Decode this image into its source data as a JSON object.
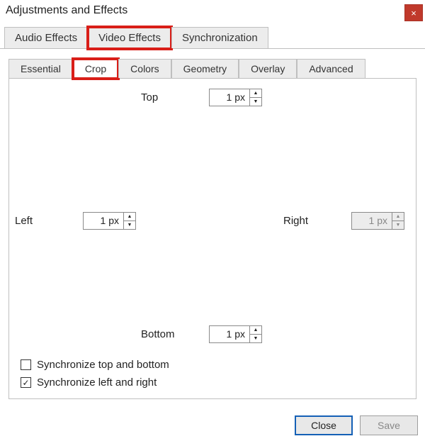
{
  "window": {
    "title": "Adjustments and Effects",
    "close_icon": "×"
  },
  "tabs_primary": [
    {
      "label": "Audio Effects",
      "active": false,
      "highlight": false
    },
    {
      "label": "Video Effects",
      "active": false,
      "highlight": true
    },
    {
      "label": "Synchronization",
      "active": false,
      "highlight": false
    }
  ],
  "tabs_secondary": [
    {
      "label": "Essential",
      "active": false,
      "highlight": false
    },
    {
      "label": "Crop",
      "active": true,
      "highlight": true
    },
    {
      "label": "Colors",
      "active": false,
      "highlight": false
    },
    {
      "label": "Geometry",
      "active": false,
      "highlight": false
    },
    {
      "label": "Overlay",
      "active": false,
      "highlight": false
    },
    {
      "label": "Advanced",
      "active": false,
      "highlight": false
    }
  ],
  "crop": {
    "top": {
      "label": "Top",
      "value": "1 px",
      "enabled": true
    },
    "left": {
      "label": "Left",
      "value": "1 px",
      "enabled": true
    },
    "right": {
      "label": "Right",
      "value": "1 px",
      "enabled": false
    },
    "bottom": {
      "label": "Bottom",
      "value": "1 px",
      "enabled": true
    }
  },
  "checkboxes": {
    "sync_tb": {
      "label": "Synchronize top and bottom",
      "checked": false
    },
    "sync_lr": {
      "label": "Synchronize left and right",
      "checked": true
    }
  },
  "footer": {
    "close": "Close",
    "save": "Save"
  }
}
